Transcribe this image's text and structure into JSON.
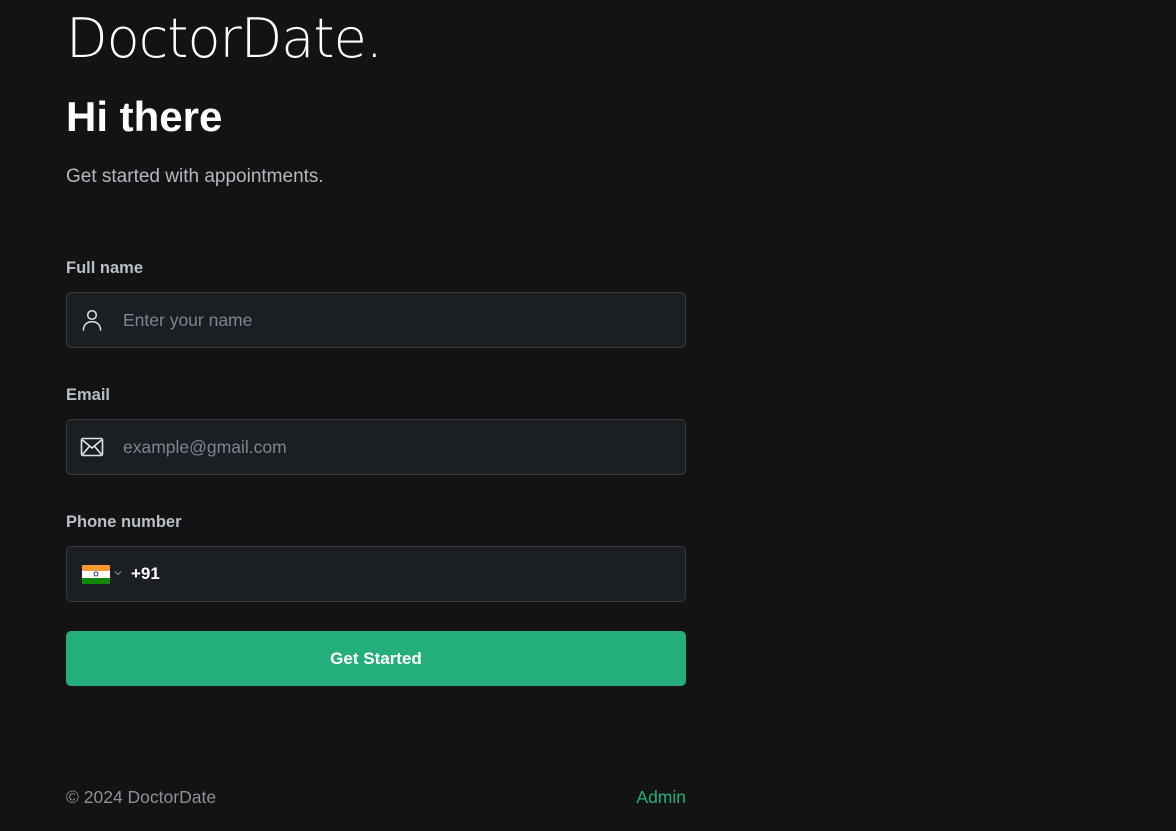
{
  "brand": {
    "logo_text": "DoctorDate."
  },
  "hero": {
    "title": "Hi there",
    "subtitle": "Get started with appointments."
  },
  "form": {
    "full_name": {
      "label": "Full name",
      "placeholder": "Enter your name",
      "value": "",
      "icon": "user-icon"
    },
    "email": {
      "label": "Email",
      "placeholder": "example@gmail.com",
      "value": "",
      "icon": "mail-icon"
    },
    "phone": {
      "label": "Phone number",
      "country": "India",
      "country_code": "+91",
      "value": "",
      "icon": "india-flag-icon"
    },
    "submit_label": "Get Started"
  },
  "footer": {
    "copyright": "© 2024 DoctorDate",
    "admin_link": "Admin"
  },
  "colors": {
    "background": "#131313",
    "accent": "#24ae7c",
    "input_background": "#1b1e23",
    "input_border": "#363a41"
  }
}
